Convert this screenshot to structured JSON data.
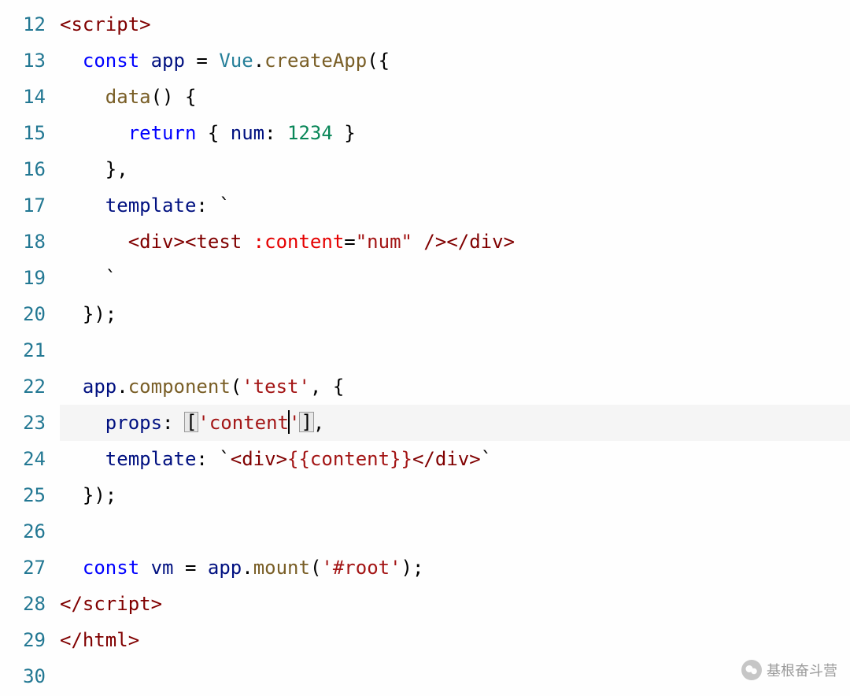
{
  "gutter": {
    "lines": [
      "12",
      "13",
      "14",
      "15",
      "16",
      "17",
      "18",
      "19",
      "20",
      "21",
      "22",
      "23",
      "24",
      "25",
      "26",
      "27",
      "28",
      "29",
      "30"
    ]
  },
  "code": {
    "l12": {
      "tag_open": "<",
      "tag_name": "script",
      "tag_close": ">"
    },
    "l13": {
      "kw_const": "const",
      "var_app": "app",
      "eq": " = ",
      "cls_vue": "Vue",
      "dot": ".",
      "fn_create": "createApp",
      "paren_brace": "({"
    },
    "l14": {
      "fn_data": "data",
      "sig": "() {"
    },
    "l15": {
      "kw_return": "return",
      "brace_open": " { ",
      "prop_num": "num",
      "colon": ": ",
      "val_num": "1234",
      "brace_close": " }"
    },
    "l16": {
      "close": "},"
    },
    "l17": {
      "prop_template": "template",
      "colon_tick": ": `"
    },
    "l18": {
      "s_open1": "<",
      "s_div1": "div",
      "s_close1": ">",
      "s_open2": "<",
      "s_test": "test",
      "s_sp": " ",
      "s_attr": ":content",
      "s_eq": "=",
      "s_qv": "\"num\"",
      "s_selfclose": " />",
      "s_open3": "</",
      "s_div2": "div",
      "s_close3": ">"
    },
    "l19": {
      "tick": "`"
    },
    "l20": {
      "close": "});"
    },
    "l22": {
      "var_app": "app",
      "dot": ".",
      "fn_component": "component",
      "open": "(",
      "str_test": "'test'",
      "comma": ", {",
      "dummy": ""
    },
    "l23": {
      "prop_props": "props",
      "colon": ": ",
      "br_open": "[",
      "str_content": "'content",
      "caret": "",
      "str_end": "'",
      "br_close": "]",
      "comma": ","
    },
    "l24": {
      "prop_template": "template",
      "colon_tick": ": `",
      "s_open1": "<",
      "s_div1": "div",
      "s_close1": ">",
      "s_expr": "{{content}}",
      "s_open2": "</",
      "s_div2": "div",
      "s_close2": ">",
      "tick_end": "`"
    },
    "l25": {
      "close": "});"
    },
    "l27": {
      "kw_const": "const",
      "var_vm": "vm",
      "eq": " = ",
      "var_app": "app",
      "dot": ".",
      "fn_mount": "mount",
      "open": "(",
      "str_root": "'#root'",
      "close": ");"
    },
    "l28": {
      "tag_open": "</",
      "tag_name": "script",
      "tag_close": ">"
    },
    "l29": {
      "tag_open": "</",
      "tag_name": "html",
      "tag_close": ">"
    }
  },
  "watermark": {
    "text": "基根奋斗营"
  }
}
